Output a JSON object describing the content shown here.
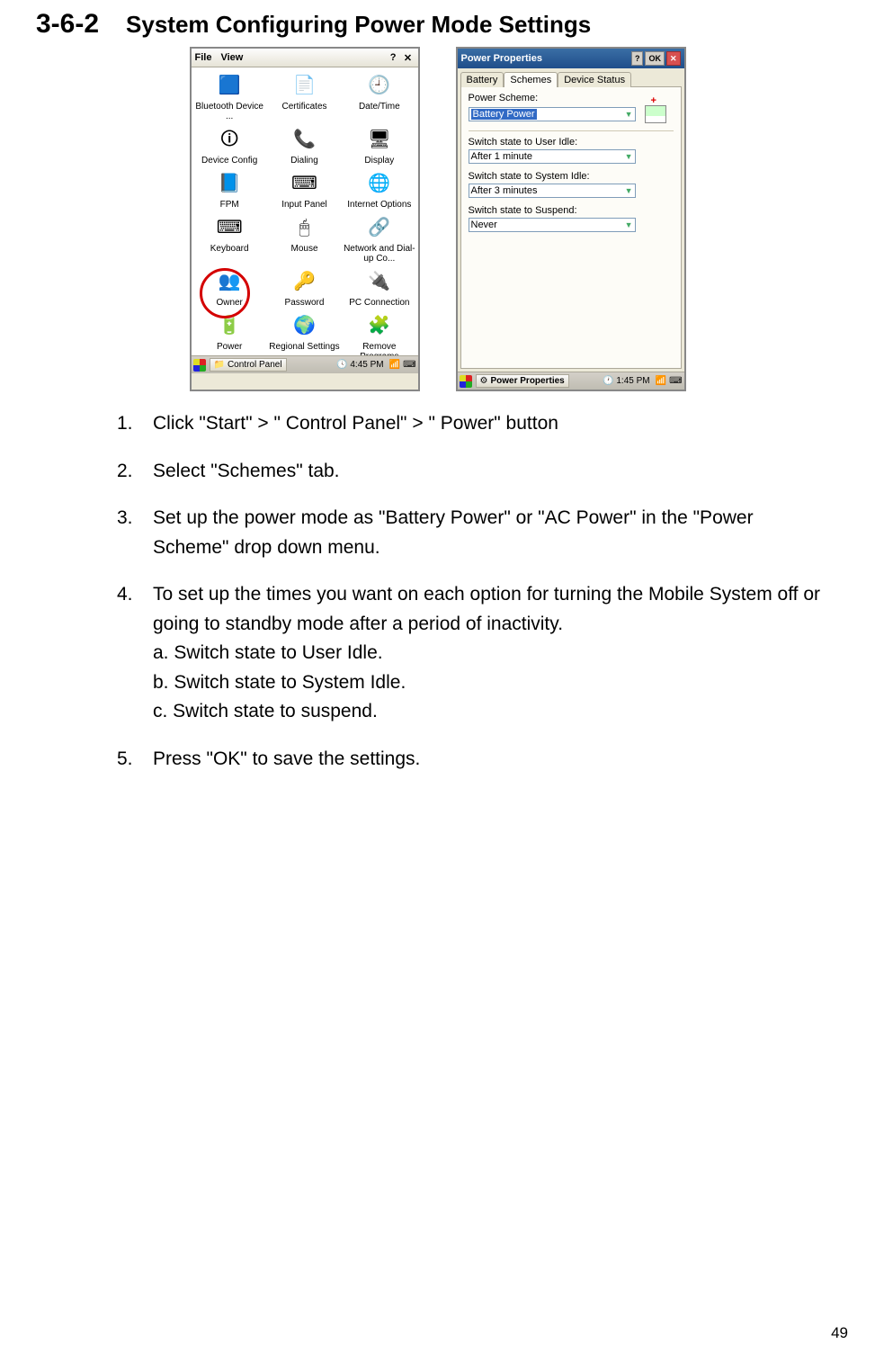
{
  "heading": {
    "number": "3-6-2",
    "title": "System Configuring Power Mode Settings"
  },
  "control_panel": {
    "menu": {
      "file": "File",
      "view": "View"
    },
    "items": [
      {
        "label": "Bluetooth Device ...",
        "icon": "🟦"
      },
      {
        "label": "Certificates",
        "icon": "📄"
      },
      {
        "label": "Date/Time",
        "icon": "🕘"
      },
      {
        "label": "Device Config",
        "icon": "🛈"
      },
      {
        "label": "Dialing",
        "icon": "📞"
      },
      {
        "label": "Display",
        "icon": "🖥"
      },
      {
        "label": "FPM",
        "icon": "📘"
      },
      {
        "label": "Input Panel",
        "icon": "⌨"
      },
      {
        "label": "Internet Options",
        "icon": "🌐"
      },
      {
        "label": "Keyboard",
        "icon": "⌨"
      },
      {
        "label": "Mouse",
        "icon": "🖱"
      },
      {
        "label": "Network and Dial-up Co...",
        "icon": "🔗"
      },
      {
        "label": "Owner",
        "icon": "👥"
      },
      {
        "label": "Password",
        "icon": "🔑"
      },
      {
        "label": "PC Connection",
        "icon": "🔌"
      },
      {
        "label": "Power",
        "icon": "🔋"
      },
      {
        "label": "Regional Settings",
        "icon": "🌍"
      },
      {
        "label": "Remove Programs",
        "icon": "🧩"
      }
    ],
    "taskbar_app": "Control Panel",
    "clock": "4:45 PM"
  },
  "power_props": {
    "title": "Power Properties",
    "ok": "OK",
    "tabs": {
      "battery": "Battery",
      "schemes": "Schemes",
      "device": "Device Status"
    },
    "scheme_lbl": "Power Scheme:",
    "scheme_val": "Battery Power",
    "user_idle_lbl": "Switch state to User Idle:",
    "user_idle_val": "After 1 minute",
    "sys_idle_lbl": "Switch state to System Idle:",
    "sys_idle_val": "After 3 minutes",
    "suspend_lbl": "Switch state to Suspend:",
    "suspend_val": "Never",
    "taskbar_app": "Power Properties",
    "clock": "1:45 PM"
  },
  "steps": {
    "s1": "Click \"Start\" > \" Control Panel\" > \" Power\" button",
    "s2": "Select \"Schemes\" tab.",
    "s3": "Set up the power mode as \"Battery Power\" or \"AC Power\" in the \"Power Scheme\" drop down menu.",
    "s4_main": "To set up the times you want on each option for turning the Mobile System off or going to standby mode after a period of inactivity.",
    "s4a": "a. Switch state to User Idle.",
    "s4b": "b. Switch state to System Idle.",
    "s4c": "c. Switch state to suspend.",
    "s5": "Press \"OK\" to save the settings."
  },
  "page_number": "49"
}
